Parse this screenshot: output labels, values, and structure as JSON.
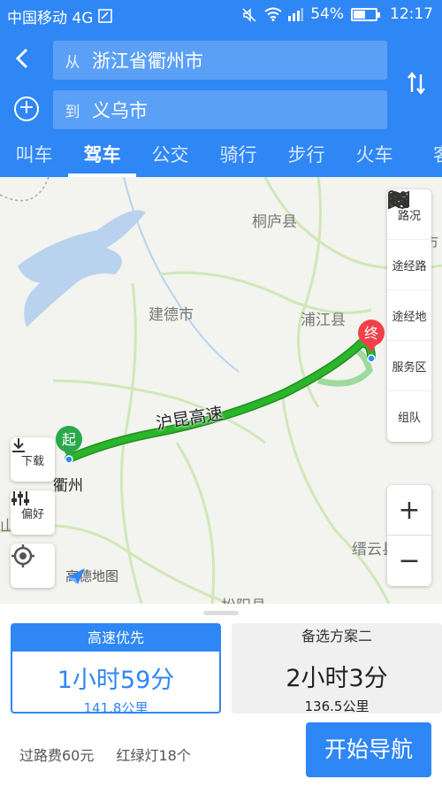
{
  "status_bar": {
    "carrier": "中国移动 4G",
    "battery": "54%",
    "battery_level": 0.54,
    "time": "12:17"
  },
  "search": {
    "from_prefix": "从",
    "from_value": "浙江省衢州市",
    "to_prefix": "到",
    "to_value": "义乌市"
  },
  "tabs": [
    {
      "label": "叫车",
      "active": false
    },
    {
      "label": "驾车",
      "active": true
    },
    {
      "label": "公交",
      "active": false
    },
    {
      "label": "骑行",
      "active": false
    },
    {
      "label": "步行",
      "active": false
    },
    {
      "label": "火车",
      "active": false
    },
    {
      "label": "客",
      "active": false
    }
  ],
  "map": {
    "labels": {
      "tonglu": "桐庐县",
      "jiande": "建德市",
      "pujiang": "浦江县",
      "quzhou": "衢州",
      "jinyun": "缙云县",
      "songyang": "松阳县",
      "zhuji": "诸暨市",
      "shan": "山"
    },
    "road_label": "沪昆高速",
    "start_marker": "起",
    "end_marker": "终",
    "side_panel": {
      "traffic": "路况",
      "via_road": "途经路",
      "via_place": "途经地",
      "service": "服务区",
      "group": "组队"
    },
    "zoom_in": "+",
    "zoom_out": "−",
    "download": "下载",
    "preference": "偏好",
    "logo": "高德地图",
    "colors": {
      "route": "#2bb52b",
      "alt_route": "#9ed99e",
      "start": "#2aa84a",
      "end": "#f0404a"
    }
  },
  "routes": {
    "selected": {
      "header": "高速优先",
      "time": "1小时59分",
      "distance": "141.8公里"
    },
    "alternative": {
      "header": "备选方案二",
      "time": "2小时3分",
      "distance": "136.5公里"
    }
  },
  "trip_info": {
    "toll": "过路费60元",
    "lights": "红绿灯18个"
  },
  "start_button": "开始导航"
}
